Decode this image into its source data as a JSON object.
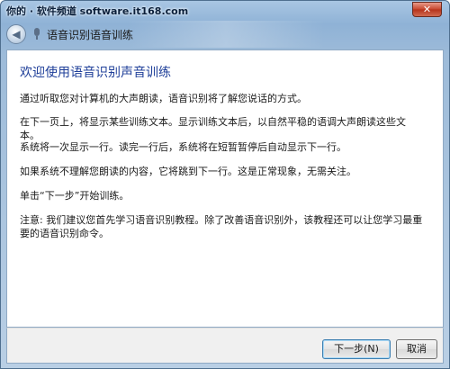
{
  "watermark": "你的 · 软件频道 software.it168.com",
  "close_label": "✕",
  "nav": {
    "back_icon": "arrow-left",
    "title": "语音识别语音训练"
  },
  "content": {
    "heading": "欢迎使用语音识别声音训练",
    "paragraphs": [
      "通过听取您对计算机的大声朗读，语音识别将了解您说话的方式。",
      "在下一页上，将显示某些训练文本。显示训练文本后，以自然平稳的语调大声朗读这些文本。",
      "系统将一次显示一行。读完一行后，系统将在短暂暂停后自动显示下一行。",
      "如果系统不理解您朗读的内容，它将跳到下一行。这是正常现象，无需关注。",
      "单击“下一步”开始训练。",
      "注意: 我们建议您首先学习语音识别教程。除了改善语音识别外，该教程还可以让您学习最重要的语音识别命令。"
    ]
  },
  "footer": {
    "next_label": "下一步(N)",
    "cancel_label": "取消"
  }
}
